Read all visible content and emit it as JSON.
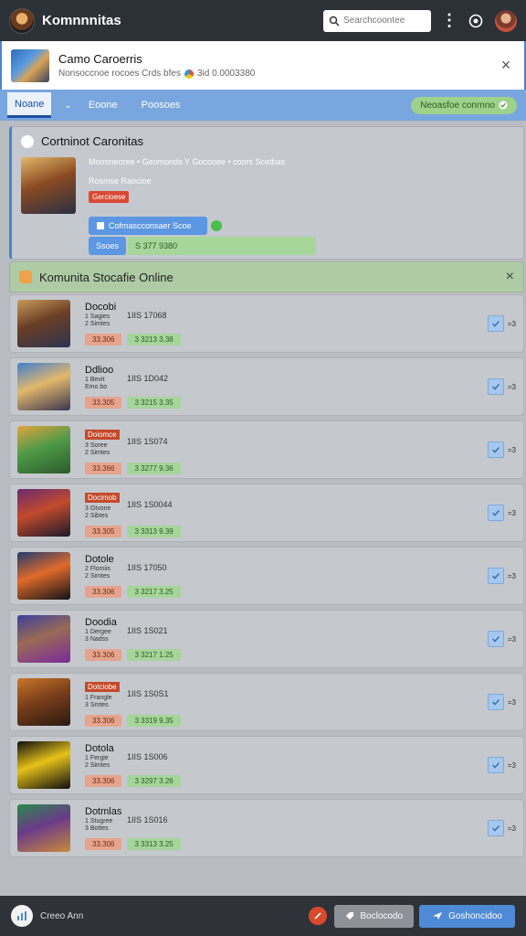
{
  "app": {
    "title": "Komnnnitas"
  },
  "search": {
    "placeholder": "Searchcoontee"
  },
  "banner": {
    "title": "Camo Caroerris",
    "subtitle": "Nonsoccnoe rocoes Crds bfes",
    "extra": "3id 0.0003380"
  },
  "tabs": [
    {
      "label": "Noane"
    },
    {
      "label": "Eoone"
    },
    {
      "label": "Poosoes"
    }
  ],
  "tab_chevron": "⌄",
  "tab_pill": {
    "label": "Neoasfoe conrnno"
  },
  "featured": {
    "title": "Cortninot Caronitas",
    "meta": "Mommeoree • Geomonds Y Gocooee • coors Scetbas",
    "sub": "Rosmse Raocioe",
    "badge": "Gercioese",
    "button": "Cofmascconsaer Scoe",
    "chip": "Ssoes",
    "green": "S 377 9380"
  },
  "list": {
    "title": "Komunita Stocafie Online",
    "rows": [
      {
        "name": "Docobi",
        "tag": "",
        "sub": "1 Sagies\n2 Simtes",
        "num": "1IIS 17068",
        "chip_o": "33.306",
        "chip_g": "3 3213 3.38",
        "check_text": "=3",
        "thumb": "linear-gradient(160deg,#c99a5a 0%,#6a3e25 45%,#2c3350 100%)"
      },
      {
        "name": "Ddlioo",
        "tag": "",
        "sub": "1 Bevit\nEmo bo",
        "num": "1IIS 1D042",
        "chip_o": "33.305",
        "chip_g": "3 3215 3.35",
        "check_text": "=3",
        "thumb": "linear-gradient(160deg,#3f7fd1 0%,#e2b86b 45%,#3a3550 100%)"
      },
      {
        "name": "",
        "tag": "Doiomce",
        "sub": "3 Soree\n2 Simtes",
        "num": "1IIS 1S074",
        "chip_o": "33.366",
        "chip_g": "3 3277 9.36",
        "check_text": "=3",
        "thumb": "linear-gradient(160deg,#e0a53e 0%,#4f9a48 45%,#2c5a2a 100%)"
      },
      {
        "name": "",
        "tag": "Docimob",
        "sub": "3 Gtvone\n2 Sibtes",
        "num": "1IIS 1S0044",
        "chip_o": "33.305",
        "chip_g": "3 3313 9.39",
        "check_text": "=3",
        "thumb": "linear-gradient(160deg,#6a2a6e 0%,#c24a2c 45%,#1c1a2a 100%)"
      },
      {
        "name": "Dotole",
        "tag": "",
        "sub": "2 Flomiis\n2 Simtes",
        "num": "1IIS 17050",
        "chip_o": "33.306",
        "chip_g": "3 3217 3.25",
        "check_text": "=3",
        "thumb": "linear-gradient(160deg,#1f3a6e 0%,#e06a2a 45%,#101218 100%)"
      },
      {
        "name": "Doodia",
        "tag": "",
        "sub": "1 Dergee\n3 Nadss",
        "num": "1IIS 1S021",
        "chip_o": "33.306",
        "chip_g": "3 3217 1.25",
        "check_text": "=3",
        "thumb": "linear-gradient(160deg,#3b3f9a 0%,#9a6a55 45%,#7a2a9a 100%)"
      },
      {
        "name": "",
        "tag": "Dotciobe",
        "sub": "1 Frangle\n3 Smtes",
        "num": "1IIS 1S0S1",
        "chip_o": "33.306",
        "chip_g": "3 3319 9.35",
        "check_text": "=3",
        "thumb": "linear-gradient(160deg,#c9782a 0%,#7a3e1a 45%,#2a1a10 100%)"
      },
      {
        "name": "Dotola",
        "tag": "",
        "sub": "1 Fergie\n2 Simtes",
        "num": "1IIS 1S006",
        "chip_o": "33.306",
        "chip_g": "3 3297 3.26",
        "check_text": "=3",
        "thumb": "linear-gradient(160deg,#0d0d0d 0%,#e6c21a 45%,#0d0d0d 100%)"
      },
      {
        "name": "Dotmlas",
        "tag": "",
        "sub": "1 Stugree\n3 Bottes",
        "num": "1IIS 1S016",
        "chip_o": "33.306",
        "chip_g": "3 3313 3.25",
        "check_text": "=3",
        "thumb": "linear-gradient(160deg,#2a8a4a 0%,#6a3a8a 45%,#c98a3a 100%)"
      }
    ]
  },
  "bottom": {
    "label": "Creeo Ann",
    "grey_button": "Boclocodo",
    "blue_button": "Goshoncidoo"
  },
  "colors": {
    "topbar": "#2c3037",
    "tab_bar": "#7aa6df",
    "accent": "#4c82d2",
    "positive": "#a6d59a",
    "warning": "#e7a48d"
  }
}
